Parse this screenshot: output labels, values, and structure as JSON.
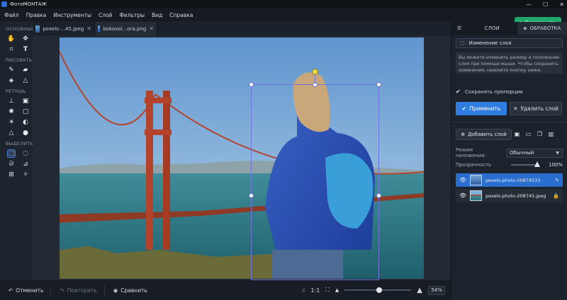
{
  "titlebar": {
    "app_title": "ФотоМОНТАЖ",
    "minimize": "—",
    "maximize": "☐",
    "close": "✕"
  },
  "menu": [
    "Файл",
    "Правка",
    "Инструменты",
    "Слой",
    "Фильтры",
    "Вид",
    "Справка"
  ],
  "save_button": {
    "label": "Сохранить",
    "icon": "download-icon",
    "color": "#1fa86a"
  },
  "tools": {
    "sections": [
      "ОСНОВНЫЕ",
      "РИСОВАТЬ",
      "РЕТУШЬ",
      "ВЫДЕЛИТЬ"
    ]
  },
  "doc_tabs": [
    {
      "label": "pexels-...45.jpeg",
      "close": "✕"
    },
    {
      "label": "bokovoi...ora.png",
      "close": "✕"
    }
  ],
  "bottombar": {
    "undo": "Отменить",
    "redo": "Повторить",
    "compare": "Сравнить",
    "ratio": "1:1",
    "zoom_value": "54%",
    "zoom_level": 0.54
  },
  "right_panel": {
    "tab_layers": "СЛОИ",
    "tab_processing": "ОБРАБОТКА",
    "change_layer": "Изменение слоя",
    "note": "Вы можете изменить размер и положение слоя при помощи мыши. Чтобы сохранить изменения, нажмите кнопку ниже.",
    "keep_proportions": "Сохранять пропорции",
    "apply": "Применить",
    "delete": "Удалить слой",
    "add_layer": "Добавить слой",
    "blend_label": "Режим наложения:",
    "blend_value": "Обычный",
    "opacity_label": "Прозрачность",
    "opacity_value": "100%",
    "layers": [
      {
        "name": "pexels-photo-20874533",
        "selected": true
      },
      {
        "name": "pexels-photo-208745.jpeg",
        "selected": false
      }
    ]
  },
  "colors": {
    "accent": "#2f7de0",
    "save": "#1fa86a",
    "transform": "#6e76d8"
  }
}
